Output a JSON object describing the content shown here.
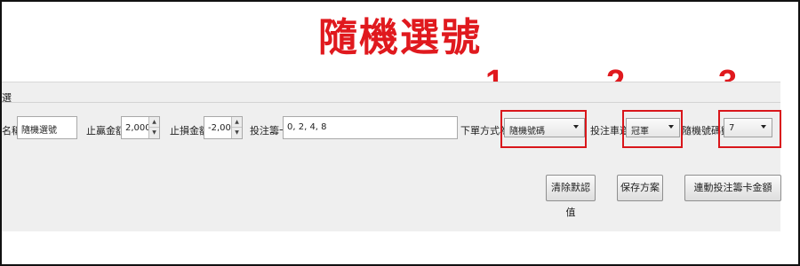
{
  "title": "隨機選號",
  "steps": [
    "1.",
    "2.",
    "3."
  ],
  "panel": {
    "header_label": "選"
  },
  "form": {
    "name_label": "名稱",
    "name_value": "隨機選號",
    "stop_win_label": "止贏金額",
    "stop_win_value": "2,000",
    "stop_loss_label": "止損金額",
    "stop_loss_value": "-2,000",
    "bet_cards_label": "投注籌卡",
    "bet_cards_value": "0, 2, 4, 8",
    "order_mode_label": "下單方式為",
    "order_mode_value": "隨機號碼",
    "lane_label": "投注車道",
    "lane_value": "冠軍",
    "random_count_label": "隨機號碼數",
    "random_count_value": "7"
  },
  "buttons": {
    "clear_defaults": "清除默認值",
    "save_plan": "保存方案",
    "link_bet_amount": "連動投注籌卡金額"
  },
  "colors": {
    "accent_red": "#e0191e"
  }
}
